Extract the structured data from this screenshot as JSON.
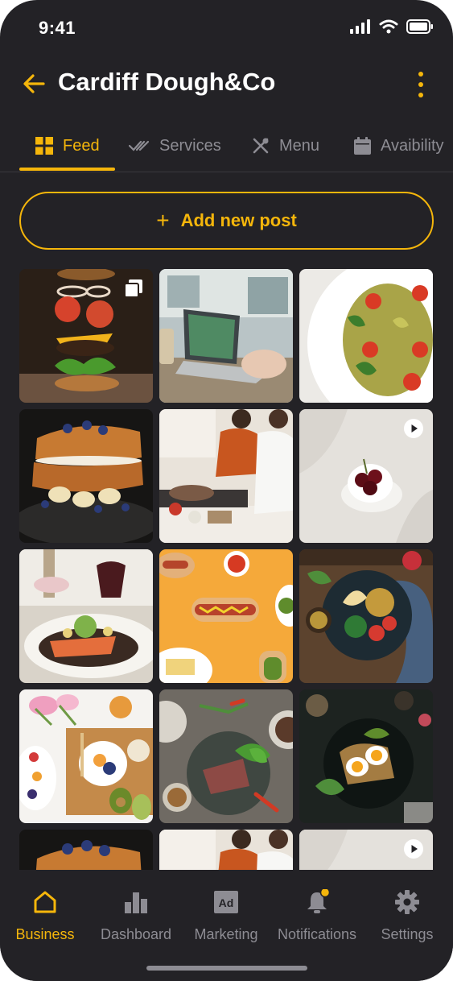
{
  "status_bar": {
    "time": "9:41"
  },
  "header": {
    "title": "Cardiff Dough&Co"
  },
  "tabs": [
    {
      "label": "Feed",
      "icon": "grid-icon",
      "active": true
    },
    {
      "label": "Services",
      "icon": "double-check-icon",
      "active": false
    },
    {
      "label": "Menu",
      "icon": "utensils-icon",
      "active": false
    },
    {
      "label": "Avaibility",
      "icon": "calendar-icon",
      "active": false
    }
  ],
  "add_post": {
    "label": "Add new post",
    "icon": "plus-icon"
  },
  "feed": {
    "posts": [
      {
        "subject": "floating burger",
        "badge": "multiple-images-icon"
      },
      {
        "subject": "laptop on desk",
        "badge": ""
      },
      {
        "subject": "bowtie pasta salad",
        "badge": ""
      },
      {
        "subject": "french toast stack",
        "badge": ""
      },
      {
        "subject": "couple cooking",
        "badge": ""
      },
      {
        "subject": "cherries in cup",
        "badge": "play-icon"
      },
      {
        "subject": "salmon dinner",
        "badge": ""
      },
      {
        "subject": "hot dogs on yellow",
        "badge": ""
      },
      {
        "subject": "chickpea salad bowl",
        "badge": ""
      },
      {
        "subject": "breakfast spread",
        "badge": ""
      },
      {
        "subject": "steak salad",
        "badge": ""
      },
      {
        "subject": "egg avocado toast",
        "badge": ""
      },
      {
        "subject": "french toast stack",
        "badge": ""
      },
      {
        "subject": "couple cooking",
        "badge": ""
      },
      {
        "subject": "cherries in cup",
        "badge": "play-icon"
      }
    ]
  },
  "bottom_nav": [
    {
      "label": "Business",
      "icon": "home-icon",
      "active": true
    },
    {
      "label": "Dashboard",
      "icon": "bar-chart-icon",
      "active": false
    },
    {
      "label": "Marketing",
      "icon": "ad-icon",
      "active": false
    },
    {
      "label": "Notifications",
      "icon": "bell-icon",
      "active": false,
      "has_dot": true
    },
    {
      "label": "Settings",
      "icon": "gear-icon",
      "active": false
    }
  ],
  "colors": {
    "background": "#232226",
    "accent": "#f5b60b",
    "muted": "#8d8c93"
  }
}
